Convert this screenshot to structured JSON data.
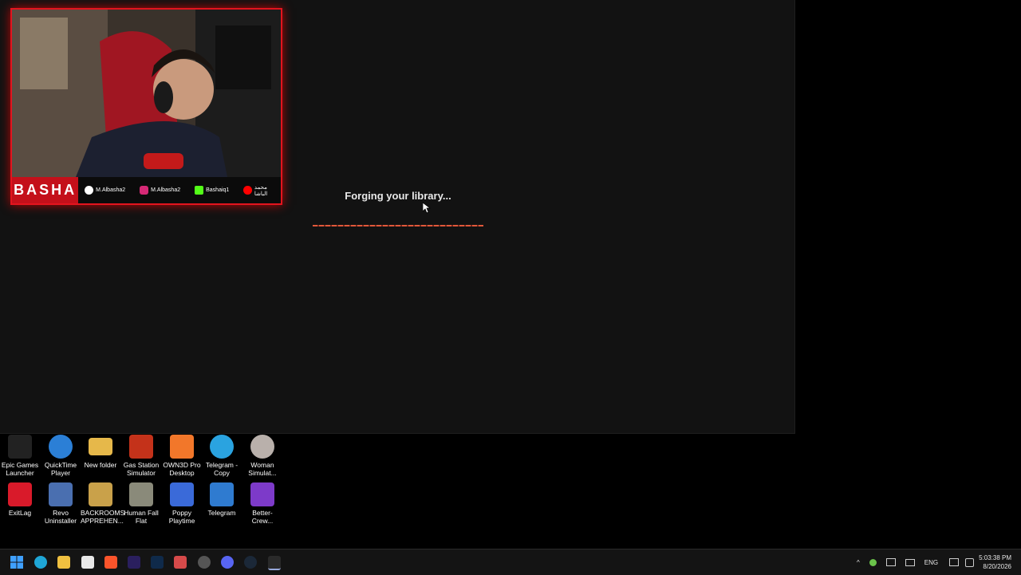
{
  "app": {
    "loading_text": "Forging your library..."
  },
  "webcam": {
    "brand": "BASHA",
    "socials": [
      {
        "handle": "M.Albasha2",
        "icon": "tiktok-icon"
      },
      {
        "handle": "M.Albasha2",
        "icon": "instagram-icon"
      },
      {
        "handle": "Bashaiq1",
        "icon": "kick-icon"
      },
      {
        "handle": "محمد الباشا",
        "icon": "youtube-icon"
      }
    ]
  },
  "desktop": {
    "icons": [
      {
        "label": "Epic Games Launcher",
        "color": "#222222"
      },
      {
        "label": "QuickTime Player",
        "color": "#2b7fd6"
      },
      {
        "label": "New folder",
        "color": "#e6b84a"
      },
      {
        "label": "Gas Station Simulator",
        "color": "#c4321a"
      },
      {
        "label": "OWN3D Pro Desktop",
        "color": "#f2772a"
      },
      {
        "label": "Telegram - Copy",
        "color": "#2aa3e0"
      },
      {
        "label": "Woman Simulat...",
        "color": "#b9b0ab"
      },
      {
        "label": "ExitLag",
        "color": "#d91a2a"
      },
      {
        "label": "Revo Uninstaller",
        "color": "#4a6fb0"
      },
      {
        "label": "BACKROOMS APPREHEN...",
        "color": "#c9a14a"
      },
      {
        "label": "Human Fall Flat",
        "color": "#8a8a7a"
      },
      {
        "label": "Poppy Playtime",
        "color": "#3a6ad9"
      },
      {
        "label": "Telegram",
        "color": "#2f7bd0"
      },
      {
        "label": "Better-Crew...",
        "color": "#7d3ac9"
      }
    ]
  },
  "taskbar": {
    "apps": [
      {
        "name": "start-button",
        "color": "#3fa0ff"
      },
      {
        "name": "edge-icon",
        "color": "#1fa6d6"
      },
      {
        "name": "file-explorer-icon",
        "color": "#f0c040"
      },
      {
        "name": "store-icon",
        "color": "#e8e8e8"
      },
      {
        "name": "brave-icon",
        "color": "#fb542b"
      },
      {
        "name": "premiere-pro-icon",
        "color": "#2a1f5e"
      },
      {
        "name": "photoshop-icon",
        "color": "#0f2a4a"
      },
      {
        "name": "snipping-tool-icon",
        "color": "#d64a4a"
      },
      {
        "name": "obs-icon",
        "color": "#555555"
      },
      {
        "name": "discord-icon",
        "color": "#5865f2"
      },
      {
        "name": "steam-icon",
        "color": "#1b2838"
      },
      {
        "name": "epic-games-taskbar-icon",
        "color": "#2a2a2a"
      }
    ],
    "language": "ENG",
    "time": "5:03:38 PM",
    "date": "8/20/2026"
  }
}
